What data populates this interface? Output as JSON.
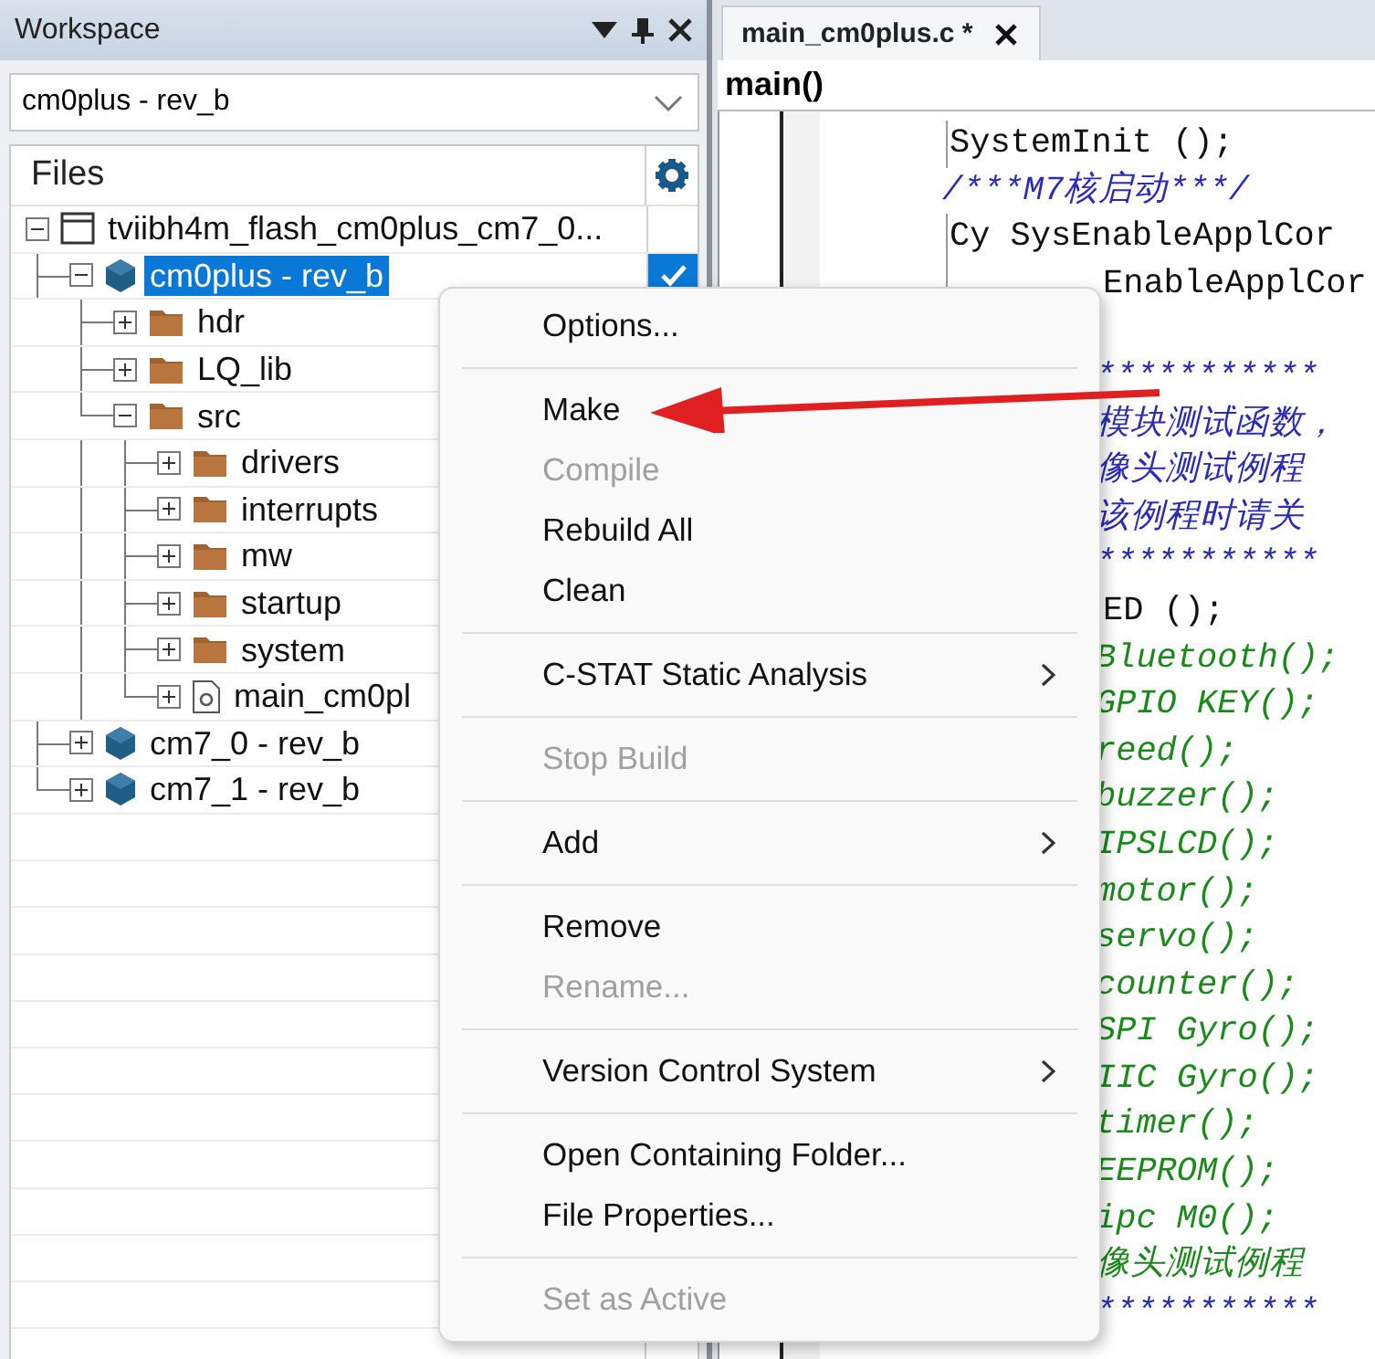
{
  "workspace": {
    "title": "Workspace",
    "config_select": {
      "value": "cm0plus - rev_b"
    },
    "files_header": "Files",
    "tree": [
      {
        "label": "tviibh4m_flash_cm0plus_cm7_0...",
        "kind": "workspace",
        "expanded": true,
        "selected": false,
        "checked": false,
        "children": [
          {
            "label": "cm0plus - rev_b",
            "kind": "project",
            "expanded": true,
            "selected": true,
            "checked": true,
            "children": [
              {
                "label": "hdr",
                "kind": "folder",
                "expanded": false,
                "selected": false,
                "checked": false
              },
              {
                "label": "LQ_lib",
                "kind": "folder",
                "expanded": false,
                "selected": false,
                "checked": false
              },
              {
                "label": "src",
                "kind": "folder",
                "expanded": true,
                "selected": false,
                "checked": false,
                "children": [
                  {
                    "label": "drivers",
                    "kind": "folder",
                    "expanded": false,
                    "selected": false,
                    "checked": false
                  },
                  {
                    "label": "interrupts",
                    "kind": "folder",
                    "expanded": false,
                    "selected": false,
                    "checked": false
                  },
                  {
                    "label": "mw",
                    "kind": "folder",
                    "expanded": false,
                    "selected": false,
                    "checked": false
                  },
                  {
                    "label": "startup",
                    "kind": "folder",
                    "expanded": false,
                    "selected": false,
                    "checked": false
                  },
                  {
                    "label": "system",
                    "kind": "folder",
                    "expanded": false,
                    "selected": false,
                    "checked": false
                  },
                  {
                    "label": "main_cm0pl",
                    "kind": "file",
                    "expanded": false,
                    "selected": false,
                    "checked": false
                  }
                ]
              }
            ]
          },
          {
            "label": "cm7_0 - rev_b",
            "kind": "project",
            "expanded": false,
            "selected": false,
            "checked": false
          },
          {
            "label": "cm7_1 - rev_b",
            "kind": "project",
            "expanded": false,
            "selected": false,
            "checked": false
          }
        ]
      }
    ]
  },
  "editor": {
    "tabs": [
      {
        "label": "main_cm0plus.c *",
        "selected": true
      }
    ],
    "function_bar": "main()",
    "lines": [
      {
        "kind": "code",
        "text": "SystemInit ();"
      },
      {
        "kind": "comment",
        "text": "/***M7核启动***/"
      },
      {
        "kind": "code",
        "text": "Cy SysEnableApplCor"
      }
    ],
    "lines_beside_menu": [
      {
        "kind": "code",
        "text": "EnableApplCor"
      },
      {
        "kind": "blank"
      },
      {
        "kind": "comment",
        "text": "***********"
      },
      {
        "kind": "comment",
        "text": "模块测试函数，"
      },
      {
        "kind": "comment",
        "text": "像头测试例程"
      },
      {
        "kind": "comment",
        "text": "该例程时请关"
      },
      {
        "kind": "comment",
        "text": "***********"
      },
      {
        "kind": "code",
        "text": "ED ();"
      },
      {
        "kind": "call",
        "text": "Bluetooth();"
      },
      {
        "kind": "call",
        "text": "GPIO KEY();"
      },
      {
        "kind": "call",
        "text": "reed();"
      },
      {
        "kind": "call",
        "text": "buzzer();"
      },
      {
        "kind": "call",
        "text": "IPSLCD();"
      },
      {
        "kind": "call",
        "text": "motor();"
      },
      {
        "kind": "call",
        "text": "servo();"
      },
      {
        "kind": "call",
        "text": "counter();"
      },
      {
        "kind": "call",
        "text": "SPI Gyro();"
      },
      {
        "kind": "call",
        "text": "IIC Gyro();"
      },
      {
        "kind": "call",
        "text": "timer();"
      },
      {
        "kind": "call",
        "text": "EEPROM();"
      },
      {
        "kind": "call",
        "text": "ipc M0();"
      },
      {
        "kind": "call",
        "text": "像头测试例程"
      },
      {
        "kind": "comment",
        "text": "***********"
      }
    ]
  },
  "context_menu": {
    "items": [
      {
        "kind": "item",
        "label": "Options...",
        "disabled": false,
        "submenu": false
      },
      {
        "kind": "separator"
      },
      {
        "kind": "item",
        "label": "Make",
        "disabled": false,
        "submenu": false
      },
      {
        "kind": "item",
        "label": "Compile",
        "disabled": true,
        "submenu": false
      },
      {
        "kind": "item",
        "label": "Rebuild All",
        "disabled": false,
        "submenu": false
      },
      {
        "kind": "item",
        "label": "Clean",
        "disabled": false,
        "submenu": false
      },
      {
        "kind": "separator"
      },
      {
        "kind": "item",
        "label": "C-STAT Static Analysis",
        "disabled": false,
        "submenu": true
      },
      {
        "kind": "separator"
      },
      {
        "kind": "item",
        "label": "Stop Build",
        "disabled": true,
        "submenu": false
      },
      {
        "kind": "separator"
      },
      {
        "kind": "item",
        "label": "Add",
        "disabled": false,
        "submenu": true
      },
      {
        "kind": "separator"
      },
      {
        "kind": "item",
        "label": "Remove",
        "disabled": false,
        "submenu": false
      },
      {
        "kind": "item",
        "label": "Rename...",
        "disabled": true,
        "submenu": false
      },
      {
        "kind": "separator"
      },
      {
        "kind": "item",
        "label": "Version Control System",
        "disabled": false,
        "submenu": true
      },
      {
        "kind": "separator"
      },
      {
        "kind": "item",
        "label": "Open Containing Folder...",
        "disabled": false,
        "submenu": false
      },
      {
        "kind": "item",
        "label": "File Properties...",
        "disabled": false,
        "submenu": false
      },
      {
        "kind": "separator"
      },
      {
        "kind": "item",
        "label": "Set as Active",
        "disabled": true,
        "submenu": false
      }
    ]
  }
}
